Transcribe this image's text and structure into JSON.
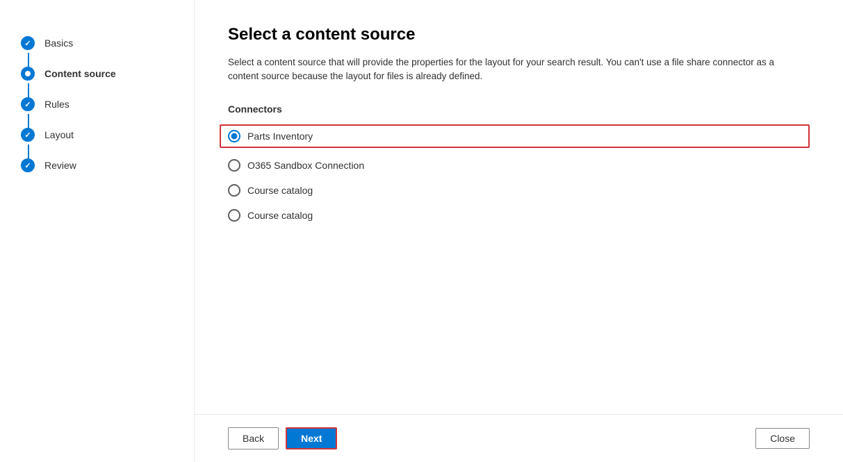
{
  "sidebar": {
    "steps": [
      {
        "id": "basics",
        "label": "Basics",
        "state": "completed"
      },
      {
        "id": "content-source",
        "label": "Content source",
        "state": "active"
      },
      {
        "id": "rules",
        "label": "Rules",
        "state": "completed"
      },
      {
        "id": "layout",
        "label": "Layout",
        "state": "completed"
      },
      {
        "id": "review",
        "label": "Review",
        "state": "completed"
      }
    ]
  },
  "main": {
    "title": "Select a content source",
    "description": "Select a content source that will provide the properties for the layout for your search result. You can't use a file share connector as a content source because the layout for files is already defined.",
    "connectors_label": "Connectors",
    "options": [
      {
        "id": "parts-inventory",
        "label": "Parts Inventory",
        "selected": true
      },
      {
        "id": "o365-sandbox",
        "label": "O365 Sandbox Connection",
        "selected": false
      },
      {
        "id": "course-catalog-1",
        "label": "Course catalog",
        "selected": false
      },
      {
        "id": "course-catalog-2",
        "label": "Course catalog",
        "selected": false
      }
    ]
  },
  "footer": {
    "back_label": "Back",
    "next_label": "Next",
    "close_label": "Close"
  }
}
